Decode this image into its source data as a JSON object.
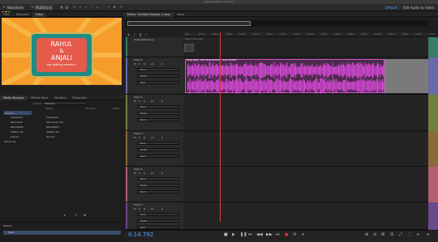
{
  "app": {
    "title": "Adobe Audition CC 2017"
  },
  "toolbar": {
    "waveform_label": "Waveform",
    "multitrack_label": "Multitrack",
    "workspace_default": "Default",
    "workspace_edit": "Edit Audio to Video"
  },
  "left_tabs": [
    "Files",
    "Favorites",
    "Video"
  ],
  "video": {
    "line1": "RAHUL",
    "line2": "&",
    "line3": "ANJALI",
    "line4": "are getting married !"
  },
  "media_tabs": [
    "Media Browser",
    "Effects Rack",
    "Markers",
    "Properties"
  ],
  "media": {
    "contents_label": "Contents:",
    "contents_value": "Volumes",
    "col_name": "Name",
    "col_duration": "Duration",
    "col_media": "Media",
    "left_items": [
      "Volumes",
      "Classwork",
      "Macintosh",
      "RECOVERY",
      "Staff11.00",
      "Transit"
    ],
    "shortcuts_label": "Shortcuts",
    "right_items": [
      "Classwork",
      "Macintosh HD",
      "RECOVERY",
      "Staff11.00",
      "Transit"
    ]
  },
  "history": {
    "title": "History",
    "item": "Open"
  },
  "editor": {
    "tab_editor": "Editor: Untitled Session 1.sesx",
    "tab_mixer": "Mixer"
  },
  "ruler_labels": [
    "hms",
    "0:10.0",
    "0:20.0",
    "0:30.0",
    "0:40.0",
    "0:50.0",
    "1:00.0",
    "1:10.0",
    "1:20.0",
    "1:30.0",
    "1:40.0",
    "1:50.0",
    "2:00.0",
    "2:10.0",
    "2:20.0",
    "2:30.0",
    "2:40.0",
    "2:50.0",
    "3:00.0"
  ],
  "tracks": [
    {
      "name": "Video Reference",
      "type": "video"
    },
    {
      "name": "Track 2",
      "vol": "+0",
      "pan": "0",
      "input": "None",
      "output": "Master",
      "mode": "Read"
    },
    {
      "name": "Track 1",
      "vol": "+0",
      "pan": "0",
      "input": "None",
      "output": "Master",
      "mode": "Read"
    },
    {
      "name": "Track 3",
      "vol": "+0",
      "pan": "0",
      "input": "None",
      "output": "Master",
      "mode": "Read"
    },
    {
      "name": "Track 4",
      "vol": "+0",
      "pan": "0",
      "input": "None",
      "output": "Master",
      "mode": "Read"
    },
    {
      "name": "Track 5",
      "vol": "+0",
      "pan": "0",
      "input": "None",
      "output": "Master",
      "mode": "Read"
    }
  ],
  "clip": {
    "label": "Baaja Baaja - Band Baaja Baaraat - Band BAARAT",
    "color": "#e04be0",
    "video_label": "Search Your Video"
  },
  "transport": {
    "timecode": "0:14.792"
  },
  "colors": {
    "accent": "#4aa3ff",
    "playhead": "#e8383d",
    "clip": "#e04be0",
    "track_stripes": [
      "#3d7b66",
      "#6a6aa8",
      "#6f8040",
      "#8a6a3a",
      "#b35d70",
      "#6a4a8a"
    ]
  }
}
